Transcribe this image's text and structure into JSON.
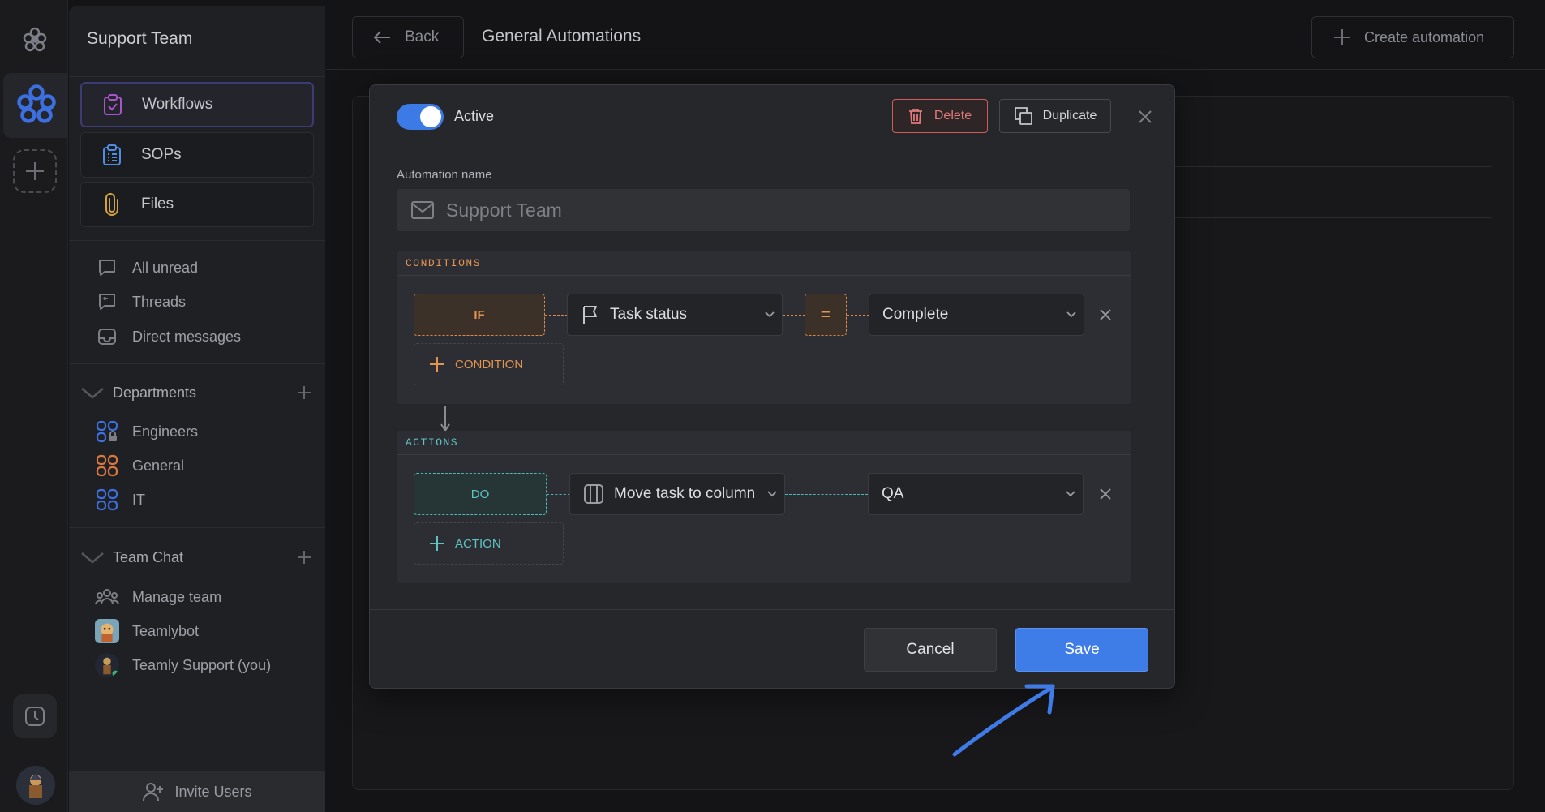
{
  "workspace": {
    "title": "Support Team"
  },
  "sidebar": {
    "nav_cards": [
      {
        "label": "Workflows"
      },
      {
        "label": "SOPs"
      },
      {
        "label": "Files"
      }
    ],
    "inbox": [
      {
        "label": "All unread"
      },
      {
        "label": "Threads"
      },
      {
        "label": "Direct messages"
      }
    ],
    "departments": {
      "label": "Departments",
      "items": [
        {
          "label": "Engineers"
        },
        {
          "label": "General"
        },
        {
          "label": "IT"
        }
      ]
    },
    "team_chat": {
      "label": "Team Chat",
      "items": [
        {
          "label": "Manage team"
        },
        {
          "label": "Teamlybot"
        },
        {
          "label": "Teamly Support (you)"
        }
      ]
    },
    "invite_label": "Invite Users"
  },
  "header": {
    "back_label": "Back",
    "title": "General Automations",
    "create_label": "Create automation"
  },
  "modal": {
    "active_label": "Active",
    "active_on": true,
    "delete_label": "Delete",
    "duplicate_label": "Duplicate",
    "name_label": "Automation name",
    "name_value": "Support Team",
    "conditions": {
      "header": "CONDITIONS",
      "if_label": "IF",
      "field": "Task status",
      "operator": "=",
      "value": "Complete",
      "add_label": "CONDITION"
    },
    "actions": {
      "header": "ACTIONS",
      "do_label": "DO",
      "action": "Move task to column",
      "value": "QA",
      "add_label": "ACTION"
    },
    "cancel_label": "Cancel",
    "save_label": "Save"
  },
  "colors": {
    "accent": "#3e7ce8",
    "condition": "#e39452",
    "action": "#5ec5c2",
    "danger": "#e27a7a",
    "annotation_arrow": "#3f7be6"
  },
  "icons": {
    "rail": [
      "logo-icon",
      "workspace-icon",
      "add-workspace-icon",
      "clock-icon",
      "user-avatar"
    ],
    "annotation": "arrow-pointing-to-save"
  }
}
